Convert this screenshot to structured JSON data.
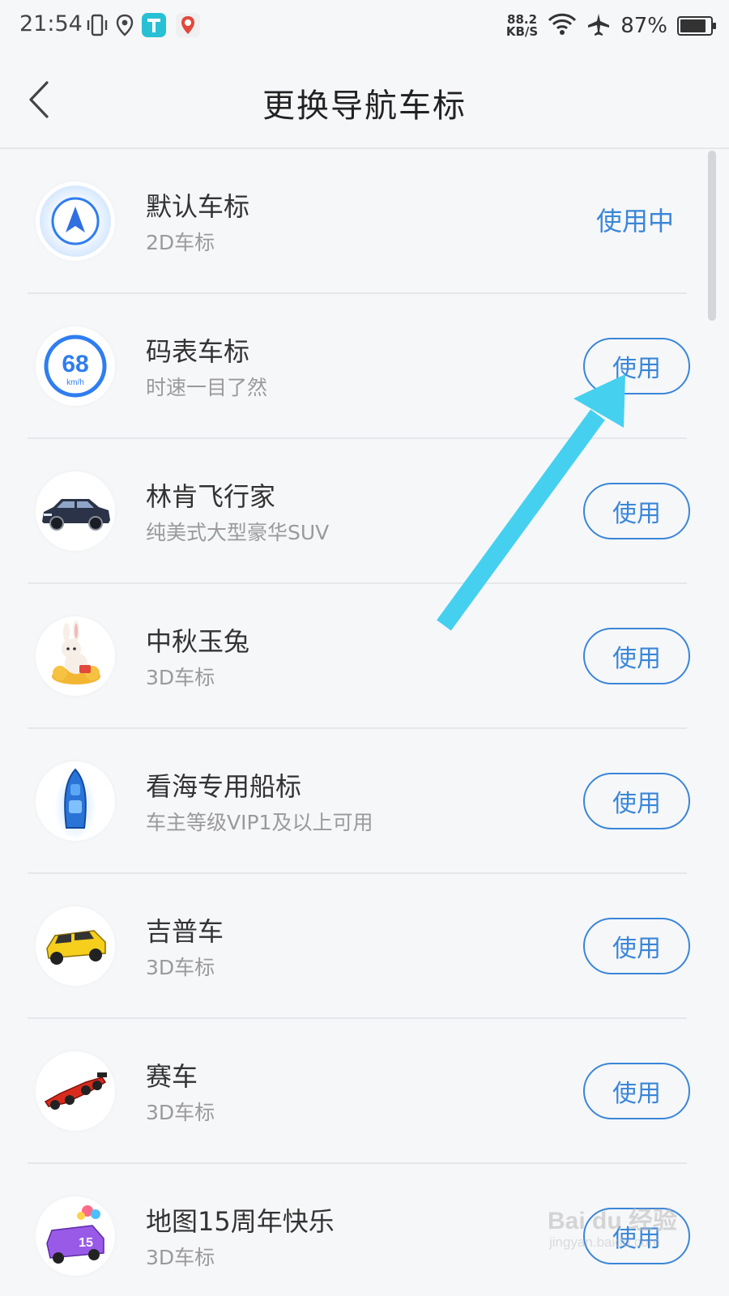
{
  "status_bar": {
    "time": "21:54",
    "net_speed_value": "88.2",
    "net_speed_unit": "KB/S",
    "battery_percent": "87%",
    "battery_level": 0.87,
    "icons": [
      "vibrate-icon",
      "location-icon",
      "app-t-icon",
      "baidu-map-icon",
      "wifi-icon",
      "airplane-icon",
      "battery-icon"
    ]
  },
  "header": {
    "title": "更换导航车标",
    "back_icon": "chevron-left-icon"
  },
  "items": [
    {
      "name": "默认车标",
      "desc": "2D车标",
      "action": "使用中",
      "icon": "navigation-arrow-icon"
    },
    {
      "name": "码表车标",
      "desc": "时速一目了然",
      "action": "使用",
      "icon": "speedometer-icon",
      "speed_value": "68",
      "speed_unit": "km/h"
    },
    {
      "name": "林肯飞行家",
      "desc": "纯美式大型豪华SUV",
      "action": "使用",
      "icon": "suv-car-icon"
    },
    {
      "name": "中秋玉兔",
      "desc": "3D车标",
      "action": "使用",
      "icon": "jade-rabbit-icon"
    },
    {
      "name": "看海专用船标",
      "desc": "车主等级VIP1及以上可用",
      "action": "使用",
      "icon": "boat-icon"
    },
    {
      "name": "吉普车",
      "desc": "3D车标",
      "action": "使用",
      "icon": "jeep-icon"
    },
    {
      "name": "赛车",
      "desc": "3D车标",
      "action": "使用",
      "icon": "race-car-icon"
    },
    {
      "name": "地图15周年快乐",
      "desc": "3D车标",
      "action": "使用",
      "icon": "anniversary-van-icon",
      "badge_text": "15"
    }
  ],
  "colors": {
    "accent": "#3a86d8",
    "annotation_arrow": "#45d0f0",
    "background": "#f6f7f9"
  },
  "watermark": {
    "brand": "Bai du 经验",
    "url": "jingyan.baidu.com"
  }
}
